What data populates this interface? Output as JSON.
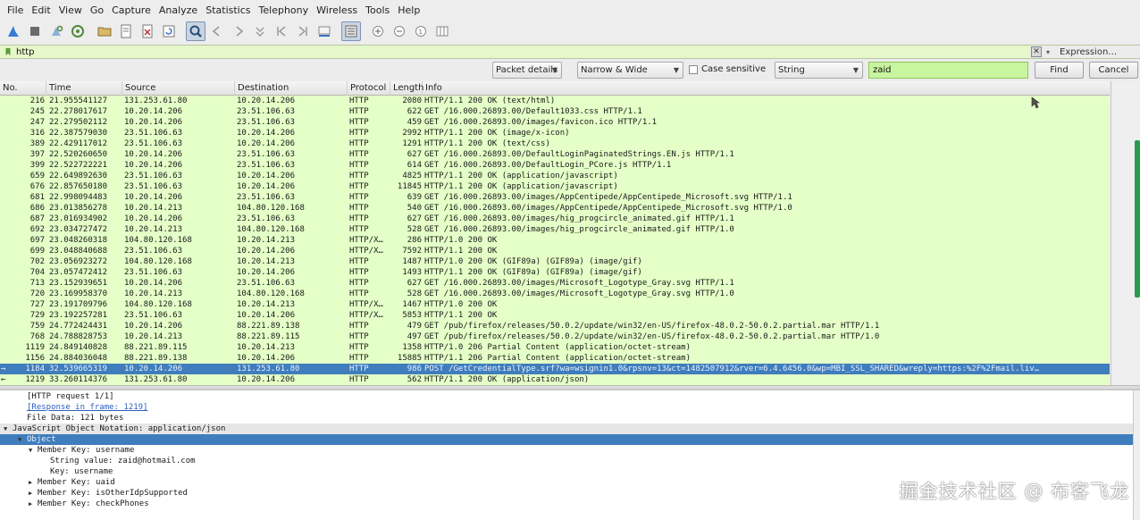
{
  "menu": [
    "File",
    "Edit",
    "View",
    "Go",
    "Capture",
    "Analyze",
    "Statistics",
    "Telephony",
    "Wireless",
    "Tools",
    "Help"
  ],
  "filter": {
    "value": "http",
    "expression_label": "Expression…"
  },
  "find": {
    "search_in": "Packet details",
    "char_width": "Narrow & Wide",
    "case_label": "Case sensitive",
    "type": "String",
    "query": "zaid",
    "find_label": "Find",
    "cancel_label": "Cancel"
  },
  "columns": {
    "no": "No.",
    "time": "Time",
    "source": "Source",
    "destination": "Destination",
    "protocol": "Protocol",
    "length": "Length",
    "info": "Info"
  },
  "packets": [
    {
      "no": "216",
      "time": "21.955541127",
      "src": "131.253.61.80",
      "dst": "10.20.14.206",
      "proto": "HTTP",
      "len": "2080",
      "info": "HTTP/1.1 200 OK  (text/html)"
    },
    {
      "no": "245",
      "time": "22.278017617",
      "src": "10.20.14.206",
      "dst": "23.51.106.63",
      "proto": "HTTP",
      "len": "622",
      "info": "GET /16.000.26893.00/Default1033.css HTTP/1.1"
    },
    {
      "no": "247",
      "time": "22.279502112",
      "src": "10.20.14.206",
      "dst": "23.51.106.63",
      "proto": "HTTP",
      "len": "459",
      "info": "GET /16.000.26893.00/images/favicon.ico HTTP/1.1"
    },
    {
      "no": "316",
      "time": "22.387579030",
      "src": "23.51.106.63",
      "dst": "10.20.14.206",
      "proto": "HTTP",
      "len": "2992",
      "info": "HTTP/1.1 200 OK  (image/x-icon)"
    },
    {
      "no": "389",
      "time": "22.429117012",
      "src": "23.51.106.63",
      "dst": "10.20.14.206",
      "proto": "HTTP",
      "len": "1291",
      "info": "HTTP/1.1 200 OK  (text/css)"
    },
    {
      "no": "397",
      "time": "22.520260650",
      "src": "10.20.14.206",
      "dst": "23.51.106.63",
      "proto": "HTTP",
      "len": "627",
      "info": "GET /16.000.26893.00/DefaultLoginPaginatedStrings.EN.js HTTP/1.1"
    },
    {
      "no": "399",
      "time": "22.522722221",
      "src": "10.20.14.206",
      "dst": "23.51.106.63",
      "proto": "HTTP",
      "len": "614",
      "info": "GET /16.000.26893.00/DefaultLogin_PCore.js HTTP/1.1"
    },
    {
      "no": "659",
      "time": "22.649892630",
      "src": "23.51.106.63",
      "dst": "10.20.14.206",
      "proto": "HTTP",
      "len": "4825",
      "info": "HTTP/1.1 200 OK  (application/javascript)"
    },
    {
      "no": "676",
      "time": "22.857650180",
      "src": "23.51.106.63",
      "dst": "10.20.14.206",
      "proto": "HTTP",
      "len": "11845",
      "info": "HTTP/1.1 200 OK  (application/javascript)"
    },
    {
      "no": "681",
      "time": "22.998094483",
      "src": "10.20.14.206",
      "dst": "23.51.106.63",
      "proto": "HTTP",
      "len": "639",
      "info": "GET /16.000.26893.00/images/AppCentipede/AppCentipede_Microsoft.svg HTTP/1.1"
    },
    {
      "no": "686",
      "time": "23.013856278",
      "src": "10.20.14.213",
      "dst": "104.80.120.168",
      "proto": "HTTP",
      "len": "540",
      "info": "GET /16.000.26893.00/images/AppCentipede/AppCentipede_Microsoft.svg HTTP/1.0"
    },
    {
      "no": "687",
      "time": "23.016934902",
      "src": "10.20.14.206",
      "dst": "23.51.106.63",
      "proto": "HTTP",
      "len": "627",
      "info": "GET /16.000.26893.00/images/hig_progcircle_animated.gif HTTP/1.1"
    },
    {
      "no": "692",
      "time": "23.034727472",
      "src": "10.20.14.213",
      "dst": "104.80.120.168",
      "proto": "HTTP",
      "len": "528",
      "info": "GET /16.000.26893.00/images/hig_progcircle_animated.gif HTTP/1.0"
    },
    {
      "no": "697",
      "time": "23.048260318",
      "src": "104.80.120.168",
      "dst": "10.20.14.213",
      "proto": "HTTP/X…",
      "len": "286",
      "info": "HTTP/1.0 200 OK"
    },
    {
      "no": "699",
      "time": "23.048840688",
      "src": "23.51.106.63",
      "dst": "10.20.14.206",
      "proto": "HTTP/X…",
      "len": "7592",
      "info": "HTTP/1.1 200 OK"
    },
    {
      "no": "702",
      "time": "23.056923272",
      "src": "104.80.120.168",
      "dst": "10.20.14.213",
      "proto": "HTTP",
      "len": "1487",
      "info": "HTTP/1.0 200 OK  (GIF89a) (GIF89a) (image/gif)"
    },
    {
      "no": "704",
      "time": "23.057472412",
      "src": "23.51.106.63",
      "dst": "10.20.14.206",
      "proto": "HTTP",
      "len": "1493",
      "info": "HTTP/1.1 200 OK  (GIF89a) (GIF89a) (image/gif)"
    },
    {
      "no": "713",
      "time": "23.152939651",
      "src": "10.20.14.206",
      "dst": "23.51.106.63",
      "proto": "HTTP",
      "len": "627",
      "info": "GET /16.000.26893.00/images/Microsoft_Logotype_Gray.svg HTTP/1.1"
    },
    {
      "no": "720",
      "time": "23.169958370",
      "src": "10.20.14.213",
      "dst": "104.80.120.168",
      "proto": "HTTP",
      "len": "528",
      "info": "GET /16.000.26893.00/images/Microsoft_Logotype_Gray.svg HTTP/1.0"
    },
    {
      "no": "727",
      "time": "23.191709796",
      "src": "104.80.120.168",
      "dst": "10.20.14.213",
      "proto": "HTTP/X…",
      "len": "1467",
      "info": "HTTP/1.0 200 OK"
    },
    {
      "no": "729",
      "time": "23.192257281",
      "src": "23.51.106.63",
      "dst": "10.20.14.206",
      "proto": "HTTP/X…",
      "len": "5853",
      "info": "HTTP/1.1 200 OK"
    },
    {
      "no": "759",
      "time": "24.772424431",
      "src": "10.20.14.206",
      "dst": "88.221.89.138",
      "proto": "HTTP",
      "len": "479",
      "info": "GET /pub/firefox/releases/50.0.2/update/win32/en-US/firefox-48.0.2-50.0.2.partial.mar HTTP/1.1"
    },
    {
      "no": "768",
      "time": "24.788828753",
      "src": "10.20.14.213",
      "dst": "88.221.89.115",
      "proto": "HTTP",
      "len": "497",
      "info": "GET /pub/firefox/releases/50.0.2/update/win32/en-US/firefox-48.0.2-50.0.2.partial.mar HTTP/1.0"
    },
    {
      "no": "1119",
      "time": "24.849140828",
      "src": "88.221.89.115",
      "dst": "10.20.14.213",
      "proto": "HTTP",
      "len": "1358",
      "info": "HTTP/1.0 206 Partial Content  (application/octet-stream)"
    },
    {
      "no": "1156",
      "time": "24.884036048",
      "src": "88.221.89.138",
      "dst": "10.20.14.206",
      "proto": "HTTP",
      "len": "15885",
      "info": "HTTP/1.1 206 Partial Content  (application/octet-stream)"
    },
    {
      "no": "1184",
      "time": "32.539665319",
      "src": "10.20.14.206",
      "dst": "131.253.61.80",
      "proto": "HTTP",
      "len": "986",
      "info": "POST /GetCredentialType.srf?wa=wsignin1.0&rpsnv=13&ct=1482507912&rver=6.4.6456.0&wp=MBI_SSL_SHARED&wreply=https:%2F%2Fmail.liv…",
      "selected": true,
      "mark": "→"
    },
    {
      "no": "1219",
      "time": "33.260114376",
      "src": "131.253.61.80",
      "dst": "10.20.14.206",
      "proto": "HTTP",
      "len": "562",
      "info": "HTTP/1.1 200 OK  (application/json)",
      "mark": "←"
    }
  ],
  "details": [
    {
      "text": "[HTTP request 1/1]",
      "indent": 30,
      "twisty": ""
    },
    {
      "text": "[Response in frame: 1219]",
      "indent": 30,
      "twisty": "",
      "link": true
    },
    {
      "text": "File Data: 121 bytes",
      "indent": 30,
      "twisty": ""
    },
    {
      "text": "JavaScript Object Notation: application/json",
      "indent": 14,
      "twisty": "▼",
      "style": "gray"
    },
    {
      "text": "Object",
      "indent": 30,
      "twisty": "▼",
      "style": "sel"
    },
    {
      "text": "Member Key: username",
      "indent": 42,
      "twisty": "▼"
    },
    {
      "text": "String value: zaid@hotmail.com",
      "indent": 56,
      "twisty": ""
    },
    {
      "text": "Key: username",
      "indent": 56,
      "twisty": ""
    },
    {
      "text": "Member Key: uaid",
      "indent": 42,
      "twisty": "▶"
    },
    {
      "text": "Member Key: isOtherIdpSupported",
      "indent": 42,
      "twisty": "▶"
    },
    {
      "text": "Member Key: checkPhones",
      "indent": 42,
      "twisty": "▶"
    }
  ],
  "watermark": "掘金技术社区 @ 布客飞龙"
}
